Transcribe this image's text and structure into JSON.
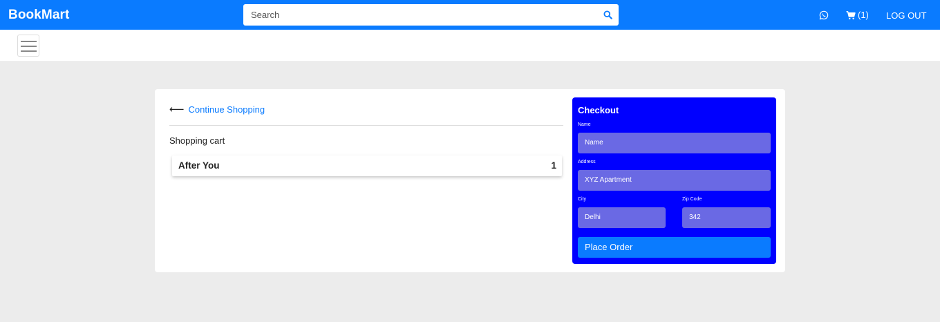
{
  "header": {
    "brand": "BookMart",
    "search_placeholder": "Search",
    "cart_count": "(1)",
    "logout_label": "LOG OUT",
    "bg_color": "#0a7bff"
  },
  "cart_page": {
    "continue_label": "Continue Shopping",
    "cart_title": "Shopping cart",
    "items": [
      {
        "name": "After You",
        "quantity": "1"
      }
    ]
  },
  "checkout": {
    "title": "Checkout",
    "bg_color": "#0000ff",
    "fields": {
      "name": {
        "label": "Name",
        "value": "Name"
      },
      "address": {
        "label": "Address",
        "value": "XYZ Apartment"
      },
      "city": {
        "label": "City",
        "value": "Delhi"
      },
      "zip": {
        "label": "Zip Code",
        "value": "342"
      }
    },
    "place_order_label": "Place Order"
  }
}
